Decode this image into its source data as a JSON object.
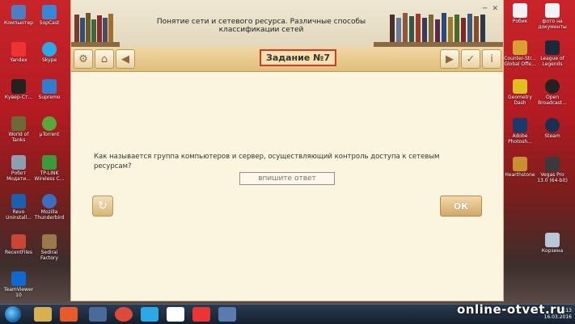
{
  "app": {
    "title": "Понятие сети и сетевого ресурса. Различные способы классификации сетей",
    "task_label": "Задание №7",
    "question": "Как называется группа компьютеров и сервер, осуществляющий контроль доступа к сетевым ресурсам?",
    "answer_placeholder": "впишите ответ",
    "ok_label": "ОК"
  },
  "desktop": {
    "left_icons": [
      "Компьютер",
      "SopCast",
      "Yandex",
      "Skype",
      "Кувер-Ст...",
      "Supremo",
      "World of Tanks",
      "µTorrent",
      "Робот Модати...",
      "TP-LINK Wireless C...",
      "Revo Uninstall...",
      "Mozilla Thunderbird",
      "RecentFiles",
      "Sedirai Factory",
      "TeamViewer 10"
    ],
    "right_icons": [
      "Робик",
      "фото на документы",
      "Counter-Str... Global Offe...",
      "League of Legends",
      "Geometry Dash",
      "Open Broadcast...",
      "Adobe Photosh...",
      "Steam",
      "Hearthstone",
      "Vegas Pro 13.0 (64-bit)",
      "Корзина"
    ]
  },
  "taskbar": {
    "time": "22:13",
    "date": "16.03.2016"
  },
  "watermark": "online-otvet.ru",
  "colors": {
    "accent": "#d03a2a",
    "toolbar": "#e0bf7b",
    "panel": "#fbf4de"
  }
}
